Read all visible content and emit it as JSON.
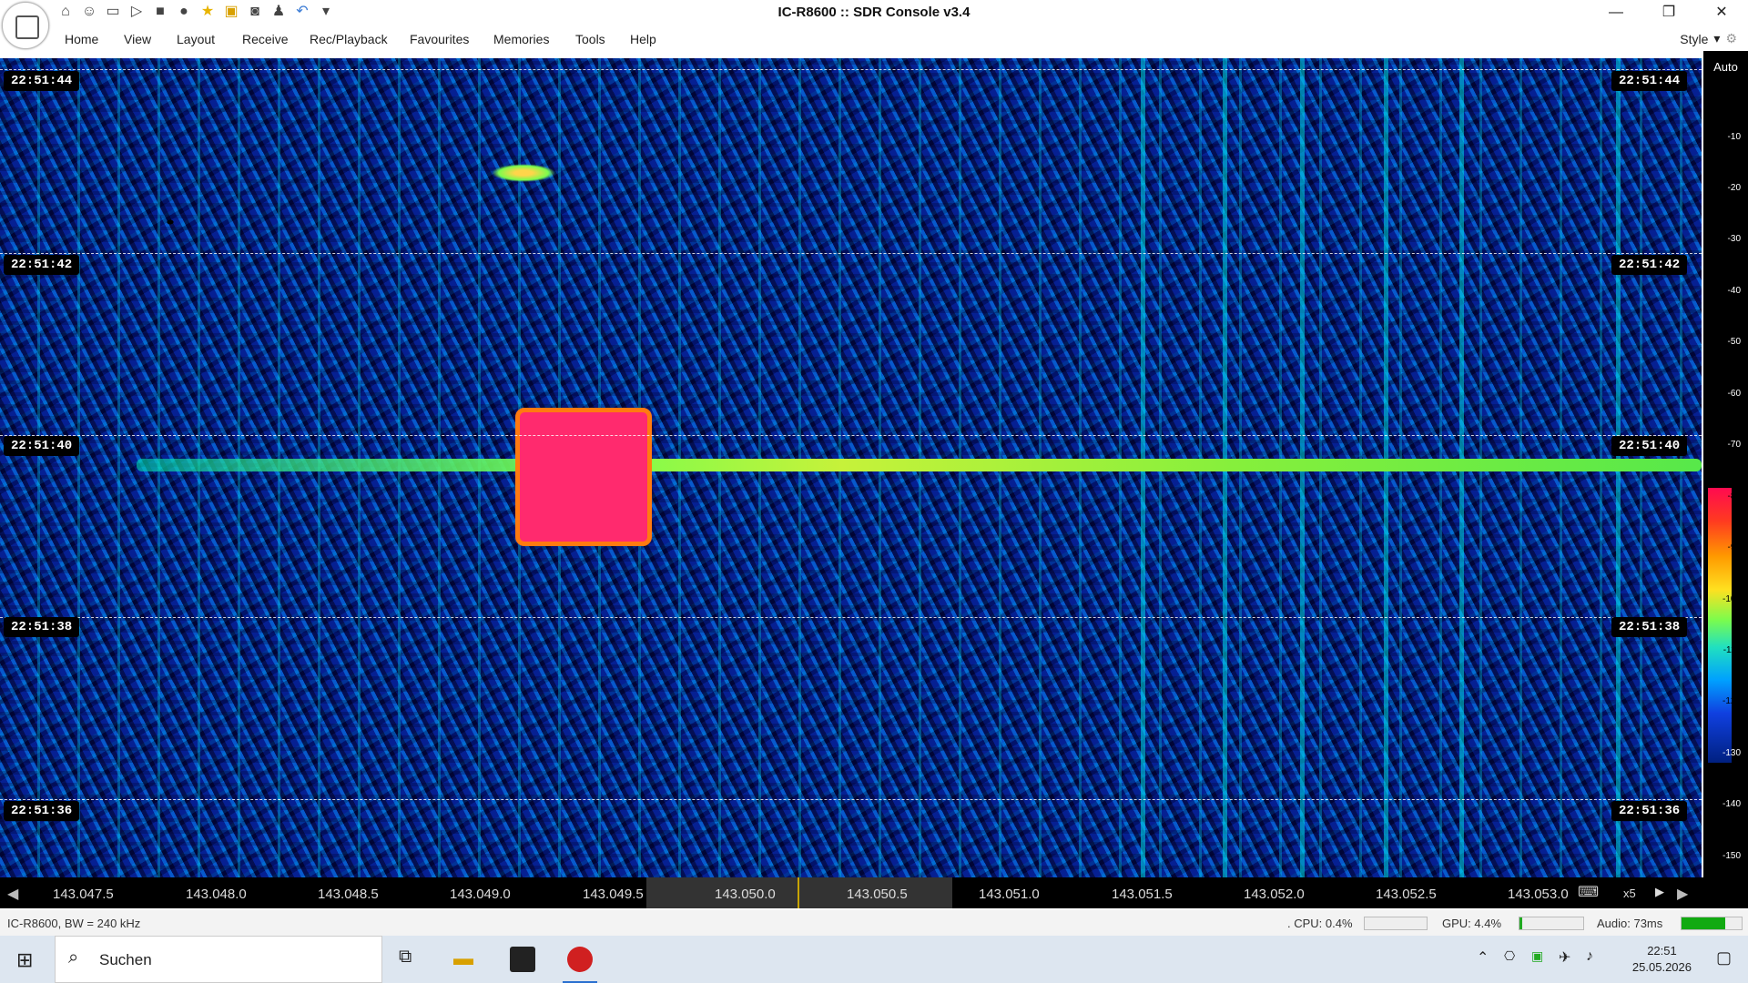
{
  "window": {
    "title": "IC-R8600 :: SDR Console v3.4"
  },
  "menu": [
    "Home",
    "View",
    "Layout",
    "Receive",
    "Rec/Playback",
    "Favourites",
    "Memories",
    "Tools",
    "Help"
  ],
  "style_label": "Style",
  "timestamps": [
    "22:51:44",
    "22:51:42",
    "22:51:40",
    "22:51:38",
    "22:51:36"
  ],
  "scale": {
    "auto": "Auto",
    "ticks": [
      "-10",
      "-20",
      "-30",
      "-40",
      "-50",
      "-60",
      "-70",
      "-80",
      "-90",
      "-100",
      "-110",
      "-120",
      "-130",
      "-140",
      "-150"
    ]
  },
  "freqs": [
    "143.047.5",
    "143.048.0",
    "143.048.5",
    "143.049.0",
    "143.049.5",
    "143.050.0",
    "143.050.5",
    "143.051.0",
    "143.051.5",
    "143.052.0",
    "143.052.5",
    "143.053.0"
  ],
  "zoom": "x5",
  "status": {
    "left": "IC-R8600, BW = 240 kHz",
    "cpu": ". CPU: 0.4%",
    "gpu": "GPU: 4.4%",
    "audio": "Audio: 73ms"
  },
  "taskbar": {
    "search": "Suchen",
    "time": "22:51",
    "date": "25.05.2026"
  }
}
